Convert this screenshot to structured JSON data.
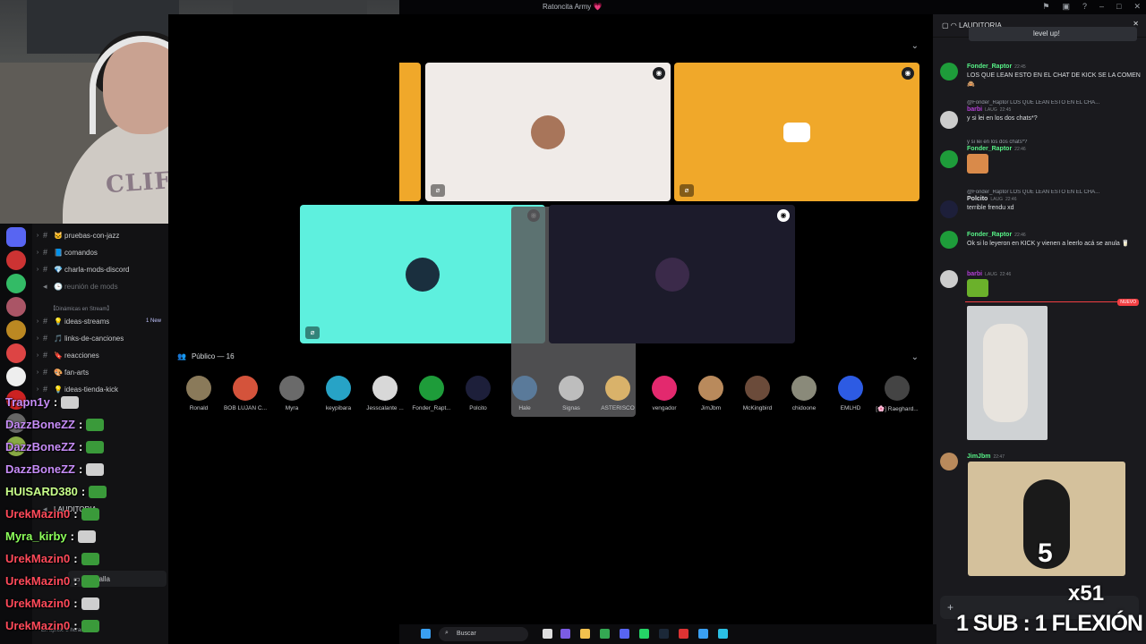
{
  "window": {
    "title": "Ratoncita Army 💗"
  },
  "sidebar": {
    "items": [
      {
        "label": "pruebas-con-jazz",
        "emoji": "🐱"
      },
      {
        "label": "comandos",
        "emoji": "📘"
      },
      {
        "label": "charla-mods-discord",
        "emoji": "💎"
      },
      {
        "label": "reunión de mods",
        "emoji": "🕒"
      },
      {
        "label": "ideas-streams",
        "emoji": "💡",
        "badge": "1 New"
      },
      {
        "label": "links-de-canciones",
        "emoji": "🎵"
      },
      {
        "label": "reacciones",
        "emoji": "🔖"
      },
      {
        "label": "fan-arts",
        "emoji": "🎨"
      },
      {
        "label": "ideas-tienda-kick",
        "emoji": "💡"
      }
    ],
    "category": "【Dinámicas en Stream】",
    "voice_channel": "LAUDITORIA",
    "screen_label": "Pantalla",
    "status": "En aprox. 3 horas"
  },
  "stage": {
    "audience_label": "Público — 16",
    "audience": [
      {
        "name": "Ronald",
        "color": "#8a7a5a"
      },
      {
        "name": "BOB LUJAN C...",
        "color": "#d4533b"
      },
      {
        "name": "Myra",
        "color": "#6a6a6a"
      },
      {
        "name": "keypibara",
        "color": "#27a3c6"
      },
      {
        "name": "Jesscalante ...",
        "color": "#d8d8d8"
      },
      {
        "name": "Fonder_Rapt...",
        "color": "#1e9c3a"
      },
      {
        "name": "Polcito",
        "color": "#1d1f3a"
      },
      {
        "name": "Hale",
        "color": "#5a7a9a"
      },
      {
        "name": "Signas",
        "color": "#bdbdbd"
      },
      {
        "name": "ASTERISCO",
        "color": "#d9b26a"
      },
      {
        "name": "vengador",
        "color": "#e3296e"
      },
      {
        "name": "JimJbm",
        "color": "#b98a5c"
      },
      {
        "name": "McKingbird",
        "color": "#6b4b3a"
      },
      {
        "name": "chidoone",
        "color": "#8a8a7a"
      },
      {
        "name": "EMLHD",
        "color": "#2d5be3"
      },
      {
        "name": "[🌸] Raeghard...",
        "color": "#444444"
      }
    ]
  },
  "chat": {
    "header": "LAUDITORIA",
    "messages": [
      {
        "user": "Fonder_Raptor",
        "time": "22:45",
        "text": "LOS QUE LEAN ESTO EN EL CHAT DE KICK SE LA COMEN🙈"
      },
      {
        "reply": "@Fonder_Raptor LOS QUE LEAN ESTO EN EL CHA...",
        "user": "barbi",
        "tag": "LAUG",
        "time": "22:45",
        "text": "y si lei en los dos chats*?"
      },
      {
        "reply": "y si lei en los dos chats*?",
        "user": "Fonder_Raptor",
        "time": "22:46",
        "text": ""
      },
      {
        "reply": "@Fonder_Raptor LOS QUE LEAN ESTO EN EL CHA...",
        "user": "Polcito",
        "tag": "LAUG",
        "time": "22:46",
        "text": "terrible frendu xd"
      },
      {
        "user": "Fonder_Raptor",
        "time": "22:46",
        "text": "Ok si lo leyeron en KICK y vienen a leerlo acá se anula 🥛"
      },
      {
        "user": "barbi",
        "tag": "LAUG",
        "time": "22:46",
        "text": ""
      },
      {
        "user": "JimJbm",
        "time": "22:47",
        "text": ""
      }
    ],
    "new_label": "NUEVO",
    "level_up": "level up!"
  },
  "overlay": {
    "lines": [
      {
        "user": "Trapn1y",
        "color": "#c68cf7"
      },
      {
        "user": "DazzBoneZZ",
        "color": "#c68cf7"
      },
      {
        "user": "DazzBoneZZ",
        "color": "#c68cf7"
      },
      {
        "user": "DazzBoneZZ",
        "color": "#c68cf7"
      },
      {
        "user": "HUISARD380",
        "color": "#c8ff8a"
      },
      {
        "user": "UrekMazin0",
        "color": "#ff4a5a"
      },
      {
        "user": "Myra_kirby",
        "color": "#8cff5a"
      },
      {
        "user": "UrekMazin0",
        "color": "#ff4a5a"
      },
      {
        "user": "UrekMazin0",
        "color": "#ff4a5a"
      },
      {
        "user": "UrekMazin0",
        "color": "#ff4a5a"
      },
      {
        "user": "UrekMazin0",
        "color": "#ff4a5a"
      }
    ],
    "banner": "1 SUB : 1 FLEXIÓN",
    "multiplier": "x51",
    "gif_number": "5"
  },
  "taskbar": {
    "search": "Buscar"
  }
}
